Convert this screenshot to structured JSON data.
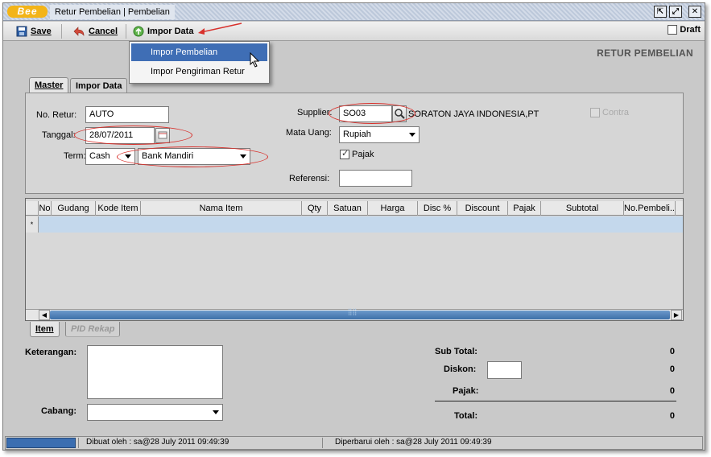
{
  "window": {
    "logo": "Bee",
    "title": "Retur Pembelian | Pembelian"
  },
  "toolbar": {
    "save_label": "Save",
    "cancel_label": "Cancel",
    "impor_label": "Impor Data",
    "draft_label": "Draft",
    "draft_checked": false
  },
  "impor_menu": {
    "items": [
      "Impor Pembelian",
      "Impor Pengiriman Retur"
    ],
    "highlighted": "Impor Pembelian"
  },
  "page_heading": "RETUR PEMBELIAN",
  "tabs": {
    "master": "Master",
    "impor_data": "Impor Data"
  },
  "form": {
    "no_retur_label": "No. Retur:",
    "no_retur_value": "AUTO",
    "tanggal_label": "Tanggal:",
    "tanggal_value": "28/07/2011",
    "term_label": "Term:",
    "term_value": "Cash",
    "bank_value": "Bank Mandiri",
    "supplier_label": "Supplier:",
    "supplier_code": "SO03",
    "supplier_name": "SORATON JAYA INDONESIA,PT",
    "mata_uang_label": "Mata Uang:",
    "mata_uang_value": "Rupiah",
    "pajak_label": "Pajak",
    "pajak_checked": true,
    "referensi_label": "Referensi:",
    "referensi_value": "",
    "contra_label": "Contra",
    "contra_checked": false
  },
  "grid": {
    "columns": [
      "No",
      "Gudang",
      "Kode Item",
      "Nama Item",
      "Qty",
      "Satuan",
      "Harga",
      "Disc %",
      "Discount",
      "Pajak",
      "Subtotal",
      "No.Pembeli..."
    ],
    "new_row_marker": "*",
    "rows": []
  },
  "bottom_tabs": {
    "item": "Item",
    "pid_rekap": "PID Rekap"
  },
  "footer": {
    "keterangan_label": "Keterangan:",
    "keterangan_value": "",
    "cabang_label": "Cabang:",
    "cabang_value": "",
    "sub_total_label": "Sub Total:",
    "sub_total_value": "0",
    "diskon_label": "Diskon:",
    "diskon_input": "",
    "diskon_value": "0",
    "pajak_label": "Pajak:",
    "pajak_value": "0",
    "total_label": "Total:",
    "total_value": "0"
  },
  "status": {
    "dibuat": "Dibuat oleh : sa@28 July 2011  09:49:39",
    "diperbarui": "Diperbarui oleh : sa@28 July 2011  09:49:39"
  },
  "colors": {
    "highlight": "#3f6eb5",
    "annotation": "#d8302b",
    "row_selected": "#c4d8ec"
  },
  "icons": [
    "save-icon",
    "cancel-icon",
    "import-icon",
    "search-icon",
    "calendar-icon",
    "restore-icon",
    "maximize-icon",
    "close-icon"
  ]
}
